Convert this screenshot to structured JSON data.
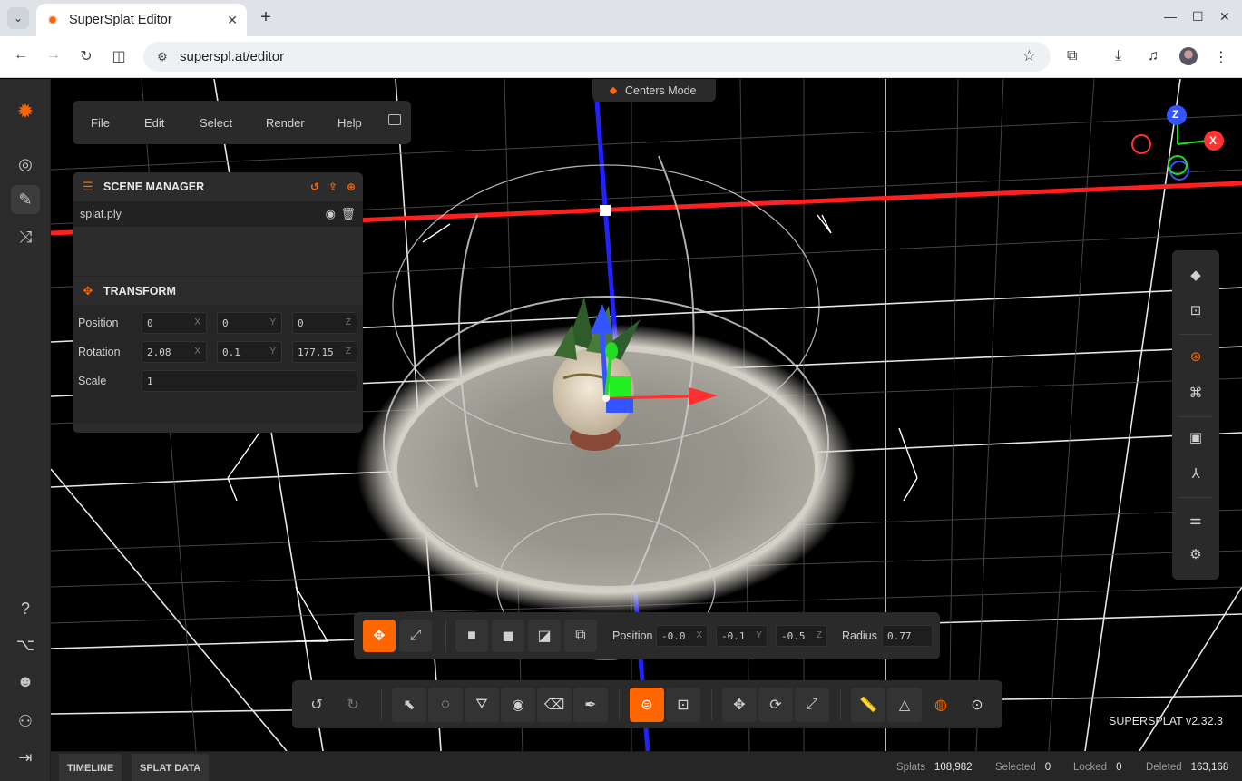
{
  "browser": {
    "tab_title": "SuperSplat Editor",
    "url": "superspl.at/editor",
    "tab_close": "✕",
    "new_tab": "+"
  },
  "menu": {
    "file": "File",
    "edit": "Edit",
    "select": "Select",
    "render": "Render",
    "help": "Help"
  },
  "centers_mode": "Centers Mode",
  "scene_manager": {
    "title": "SCENE MANAGER",
    "items": [
      {
        "name": "splat.ply"
      }
    ]
  },
  "transform": {
    "title": "TRANSFORM",
    "position_label": "Position",
    "rotation_label": "Rotation",
    "scale_label": "Scale",
    "position": {
      "x": "0",
      "y": "0",
      "z": "0"
    },
    "rotation": {
      "x": "2.08",
      "y": "0.1",
      "z": "177.15"
    },
    "scale": "1",
    "axis_x": "X",
    "axis_y": "Y",
    "axis_z": "Z"
  },
  "gizmo": {
    "axis_x": "X",
    "axis_z": "Z"
  },
  "sphere_tool": {
    "position_label": "Position",
    "position": {
      "x": "-0.0",
      "y": "-0.1",
      "z": "-0.5"
    },
    "radius_label": "Radius",
    "radius": "0.77",
    "axis_x": "X",
    "axis_y": "Y",
    "axis_z": "Z"
  },
  "version": "SUPERSPLAT v2.32.3",
  "status": {
    "timeline_tab": "TIMELINE",
    "splat_data_tab": "SPLAT DATA",
    "splats_label": "Splats",
    "splats": "108,982",
    "selected_label": "Selected",
    "selected": "0",
    "locked_label": "Locked",
    "locked": "0",
    "deleted_label": "Deleted",
    "deleted": "163,168"
  },
  "colors": {
    "accent": "#ff6600",
    "panel": "#2c2c2c",
    "axis_x": "#ff2a2a",
    "axis_y": "#22dd22",
    "axis_z": "#3344ff"
  }
}
